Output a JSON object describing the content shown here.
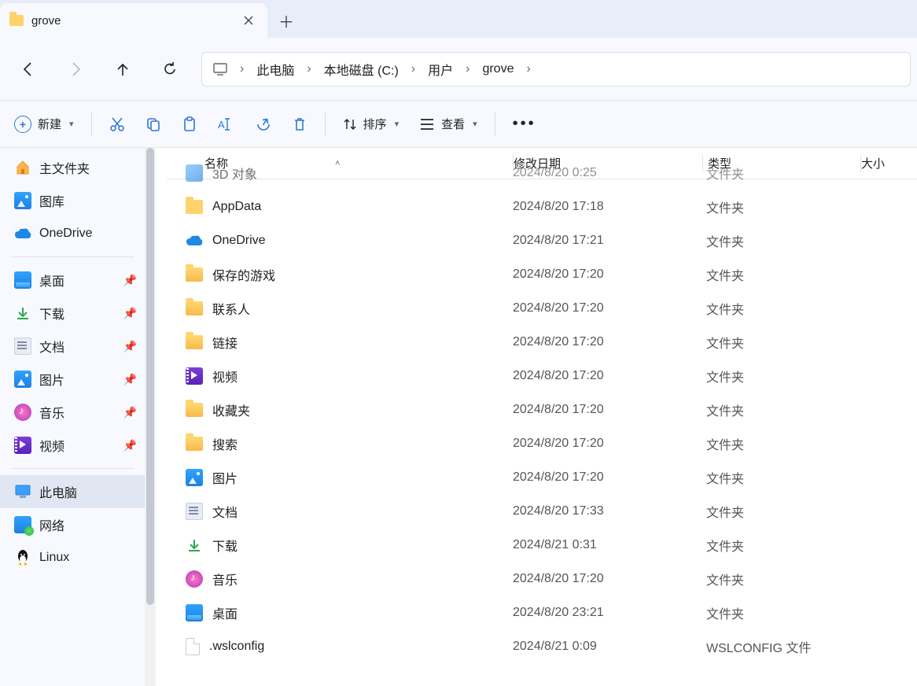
{
  "tab": {
    "title": "grove"
  },
  "breadcrumb": {
    "segments": [
      "此电脑",
      "本地磁盘 (C:)",
      "用户",
      "grove"
    ]
  },
  "toolbar": {
    "new_label": "新建",
    "sort_label": "排序",
    "view_label": "查看"
  },
  "columns": {
    "name": "名称",
    "date": "修改日期",
    "type": "类型",
    "size": "大小"
  },
  "sidebar": {
    "top": [
      {
        "label": "主文件夹",
        "icon": "home"
      },
      {
        "label": "图库",
        "icon": "gallery"
      },
      {
        "label": "OneDrive",
        "icon": "onedrive"
      }
    ],
    "pinned": [
      {
        "label": "桌面",
        "icon": "desktop"
      },
      {
        "label": "下载",
        "icon": "download"
      },
      {
        "label": "文档",
        "icon": "doc"
      },
      {
        "label": "图片",
        "icon": "gallery"
      },
      {
        "label": "音乐",
        "icon": "music"
      },
      {
        "label": "视频",
        "icon": "video"
      }
    ],
    "bottom": [
      {
        "label": "此电脑",
        "icon": "pc",
        "selected": true
      },
      {
        "label": "网络",
        "icon": "net"
      },
      {
        "label": "Linux",
        "icon": "linux"
      }
    ]
  },
  "files": [
    {
      "name": "3D 对象",
      "date": "2024/8/20 0:25",
      "type": "文件夹",
      "icon": "3d",
      "cut": true
    },
    {
      "name": "AppData",
      "date": "2024/8/20 17:18",
      "type": "文件夹",
      "icon": "folder"
    },
    {
      "name": "OneDrive",
      "date": "2024/8/20 17:21",
      "type": "文件夹",
      "icon": "onedrive"
    },
    {
      "name": "保存的游戏",
      "date": "2024/8/20 17:20",
      "type": "文件夹",
      "icon": "folder-accent"
    },
    {
      "name": "联系人",
      "date": "2024/8/20 17:20",
      "type": "文件夹",
      "icon": "folder-accent"
    },
    {
      "name": "链接",
      "date": "2024/8/20 17:20",
      "type": "文件夹",
      "icon": "folder-accent"
    },
    {
      "name": "视频",
      "date": "2024/8/20 17:20",
      "type": "文件夹",
      "icon": "video"
    },
    {
      "name": "收藏夹",
      "date": "2024/8/20 17:20",
      "type": "文件夹",
      "icon": "folder-accent"
    },
    {
      "name": "搜索",
      "date": "2024/8/20 17:20",
      "type": "文件夹",
      "icon": "folder-accent"
    },
    {
      "name": "图片",
      "date": "2024/8/20 17:20",
      "type": "文件夹",
      "icon": "gallery"
    },
    {
      "name": "文档",
      "date": "2024/8/20 17:33",
      "type": "文件夹",
      "icon": "doc"
    },
    {
      "name": "下载",
      "date": "2024/8/21 0:31",
      "type": "文件夹",
      "icon": "download"
    },
    {
      "name": "音乐",
      "date": "2024/8/20 17:20",
      "type": "文件夹",
      "icon": "music"
    },
    {
      "name": "桌面",
      "date": "2024/8/20 23:21",
      "type": "文件夹",
      "icon": "desktop"
    },
    {
      "name": ".wslconfig",
      "date": "2024/8/21 0:09",
      "type": "WSLCONFIG 文件",
      "icon": "file"
    }
  ]
}
